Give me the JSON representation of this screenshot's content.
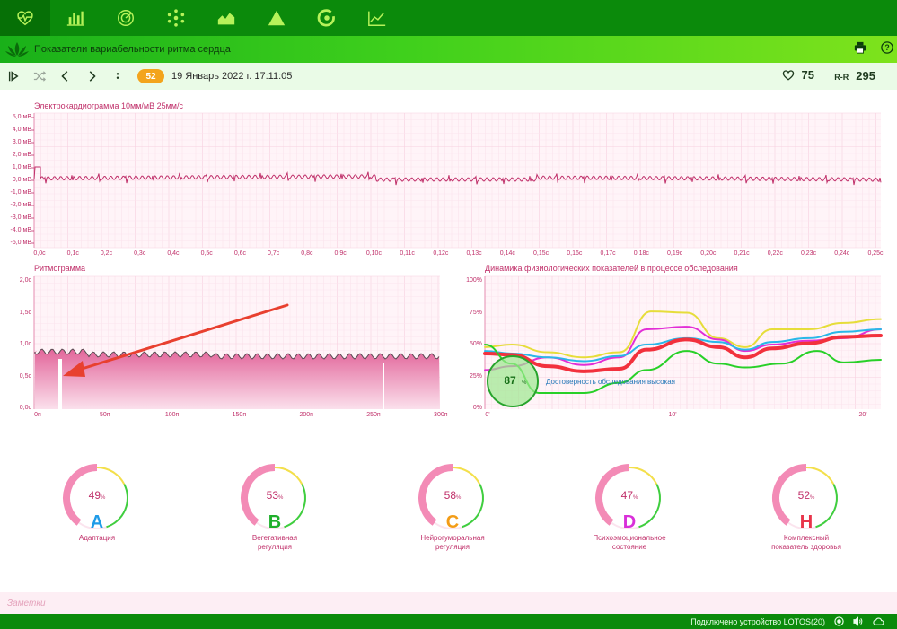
{
  "nav": {
    "items": [
      {
        "name": "heart-pulse-icon",
        "active": true
      },
      {
        "name": "bar-chart-icon"
      },
      {
        "name": "radar-icon"
      },
      {
        "name": "molecule-icon"
      },
      {
        "name": "area-chart-icon"
      },
      {
        "name": "triangle-chart-icon"
      },
      {
        "name": "circle-gauge-icon"
      },
      {
        "name": "line-chart-icon"
      }
    ]
  },
  "header": {
    "title": "Показатели вариабельности ритма сердца"
  },
  "toolbar": {
    "record_number": "52",
    "datetime": "19 Январь 2022 г. 17:11:05",
    "heart_rate": "75",
    "rr_label": "R-R",
    "rr_value": "295"
  },
  "colors": {
    "pink": "#d1437a",
    "green_dark": "#0b8a0b",
    "orange": "#f3a41d"
  },
  "ecg": {
    "title": "Электрокардиограмма 10мм/мВ 25мм/с",
    "y_labels": [
      "5,0 мВ",
      "4,0 мВ",
      "3,0 мВ",
      "2,0 мВ",
      "1,0 мВ",
      "0,0 мВ",
      "-1,0 мВ",
      "-2,0 мВ",
      "-3,0 мВ",
      "-4,0 мВ",
      "-5,0 мВ"
    ],
    "x_labels": [
      "0,0с",
      "0,1с",
      "0,2с",
      "0,3с",
      "0,4с",
      "0,5с",
      "0,6с",
      "0,7с",
      "0,8с",
      "0,9с",
      "0,10с",
      "0,11с",
      "0,12с",
      "0,13с",
      "0,14с",
      "0,15с",
      "0,16с",
      "0,17с",
      "0,18с",
      "0,19с",
      "0,20с",
      "0,21с",
      "0,22с",
      "0,23с",
      "0,24с",
      "0,25с"
    ]
  },
  "rhythmogram": {
    "title": "Ритмограмма",
    "y_labels": [
      "2,0с",
      "1,5с",
      "1,0с",
      "0,5с",
      "0,0с"
    ],
    "x_labels": [
      "0п",
      "50п",
      "100п",
      "150п",
      "200п",
      "250п",
      "300п"
    ]
  },
  "dynamics": {
    "title": "Динамика физиологических показателей в процессе обследования",
    "y_labels": [
      "100%",
      "75%",
      "50%",
      "25%",
      "0%"
    ],
    "x_labels": [
      "0'",
      "10'",
      "20'"
    ],
    "reliability_value": "87",
    "reliability_unit": "%",
    "reliability_text": "Достоверность обследования высокая",
    "series_colors": [
      "#e6dd3a",
      "#e22ed6",
      "#29b8e8",
      "#f2313d",
      "#28d028"
    ]
  },
  "gauges": [
    {
      "value": 49,
      "unit": "%",
      "letter": "A",
      "letter_color": "#1f9be8",
      "caption": [
        "Адаптация"
      ]
    },
    {
      "value": 53,
      "unit": "%",
      "letter": "B",
      "letter_color": "#1faf2b",
      "caption": [
        "Вегетативная",
        "регуляция"
      ]
    },
    {
      "value": 58,
      "unit": "%",
      "letter": "C",
      "letter_color": "#f39c16",
      "caption": [
        "Нейрогуморальная",
        "регуляция"
      ]
    },
    {
      "value": 47,
      "unit": "%",
      "letter": "D",
      "letter_color": "#d92fd9",
      "caption": [
        "Психоэмоциональное",
        "состояние"
      ]
    },
    {
      "value": 52,
      "unit": "%",
      "letter": "H",
      "letter_color": "#e8344a",
      "caption": [
        "Комплексный",
        "показатель здоровья"
      ]
    }
  ],
  "notes": {
    "placeholder": "Заметки"
  },
  "status": {
    "text": "Подключено устройство LOTOS(20)"
  }
}
